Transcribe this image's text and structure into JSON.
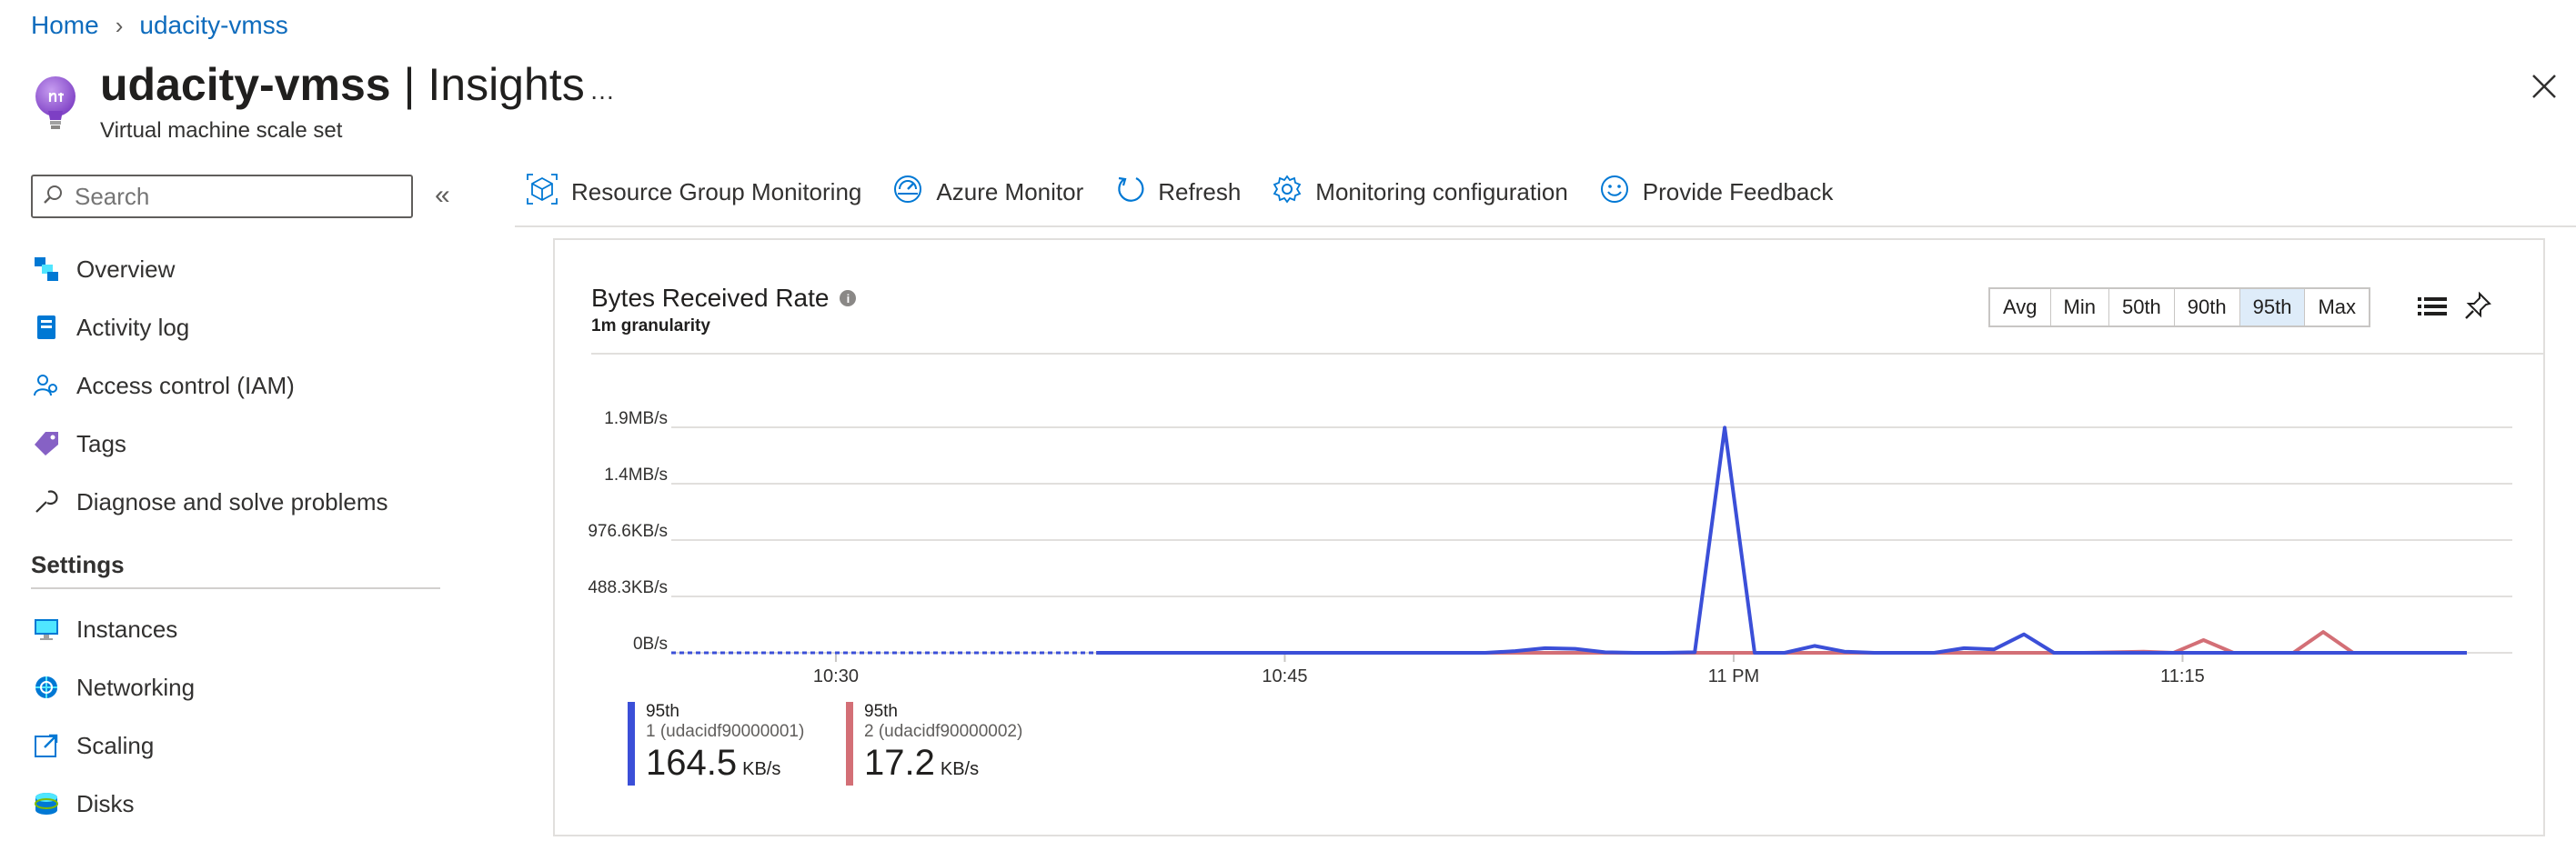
{
  "breadcrumb": {
    "home": "Home",
    "separator": "›",
    "current": "udacity-vmss"
  },
  "header": {
    "resource_name": "udacity-vmss",
    "separator": " | ",
    "page": "Insights",
    "subtitle": "Virtual machine scale set",
    "more": "…",
    "icon": "lightbulb-icon"
  },
  "sidebar": {
    "search_placeholder": "Search",
    "collapse": "«",
    "items": [
      {
        "label": "Overview",
        "icon": "overview-icon"
      },
      {
        "label": "Activity log",
        "icon": "activity-log-icon"
      },
      {
        "label": "Access control (IAM)",
        "icon": "iam-icon"
      },
      {
        "label": "Tags",
        "icon": "tag-icon"
      },
      {
        "label": "Diagnose and solve problems",
        "icon": "wrench-icon"
      }
    ],
    "settings_heading": "Settings",
    "settings_items": [
      {
        "label": "Instances",
        "icon": "monitor-icon"
      },
      {
        "label": "Networking",
        "icon": "network-icon"
      },
      {
        "label": "Scaling",
        "icon": "scaling-icon"
      },
      {
        "label": "Disks",
        "icon": "disk-icon"
      }
    ]
  },
  "toolbar": {
    "items": [
      {
        "label": "Resource Group Monitoring",
        "icon": "cube-icon"
      },
      {
        "label": "Azure Monitor",
        "icon": "gauge-icon"
      },
      {
        "label": "Refresh",
        "icon": "refresh-icon"
      },
      {
        "label": "Monitoring configuration",
        "icon": "gear-icon"
      },
      {
        "label": "Provide Feedback",
        "icon": "smiley-icon"
      }
    ]
  },
  "chart_card": {
    "title": "Bytes Received Rate",
    "granularity": "1m granularity",
    "aggregations": [
      "Avg",
      "Min",
      "50th",
      "90th",
      "95th",
      "Max"
    ],
    "selected_aggregation": "95th"
  },
  "chart_data": {
    "type": "line",
    "y_ticks": [
      "0B/s",
      "488.3KB/s",
      "976.6KB/s",
      "1.4MB/s",
      "1.9MB/s"
    ],
    "x_ticks": [
      "10:30",
      "10:45",
      "11 PM",
      "11:15"
    ],
    "y_range_kbs": [
      0,
      1953.1
    ],
    "x_range_minutes": [
      0,
      60
    ],
    "grid": true,
    "series": [
      {
        "name": "1 (udacidf90000001)",
        "aggregation": "95th",
        "color": "#3b4fd8",
        "summary_value": "164.5",
        "summary_unit": "KB/s",
        "points": [
          [
            0,
            0
          ],
          [
            14.2,
            0
          ],
          [
            17.2,
            0
          ],
          [
            22.2,
            0
          ],
          [
            27.2,
            0
          ],
          [
            28.2,
            15
          ],
          [
            29.2,
            40
          ],
          [
            30.2,
            35
          ],
          [
            31.2,
            5
          ],
          [
            32.2,
            0
          ],
          [
            33.2,
            0
          ],
          [
            34.2,
            5
          ],
          [
            35.2,
            1950
          ],
          [
            36.2,
            0
          ],
          [
            37.2,
            0
          ],
          [
            38.2,
            60
          ],
          [
            39.2,
            10
          ],
          [
            40.2,
            0
          ],
          [
            42.2,
            0
          ],
          [
            43.2,
            40
          ],
          [
            44.2,
            30
          ],
          [
            45.2,
            160
          ],
          [
            46.2,
            0
          ],
          [
            50.2,
            0
          ],
          [
            53.2,
            0
          ],
          [
            55.2,
            0
          ],
          [
            57.2,
            0
          ],
          [
            59.2,
            0
          ],
          [
            60,
            0
          ]
        ]
      },
      {
        "name": "2 (udacidf90000002)",
        "aggregation": "95th",
        "color": "#d36f76",
        "summary_value": "17.2",
        "summary_unit": "KB/s",
        "points": [
          [
            0,
            0
          ],
          [
            14.2,
            0
          ],
          [
            22.2,
            0
          ],
          [
            27.2,
            0
          ],
          [
            32.2,
            0
          ],
          [
            38.2,
            0
          ],
          [
            42.2,
            0
          ],
          [
            47.2,
            0
          ],
          [
            49.2,
            10
          ],
          [
            50.2,
            0
          ],
          [
            51.2,
            110
          ],
          [
            52.2,
            0
          ],
          [
            54.2,
            0
          ],
          [
            55.2,
            180
          ],
          [
            56.2,
            0
          ],
          [
            58.2,
            0
          ],
          [
            60,
            0
          ]
        ]
      }
    ]
  }
}
